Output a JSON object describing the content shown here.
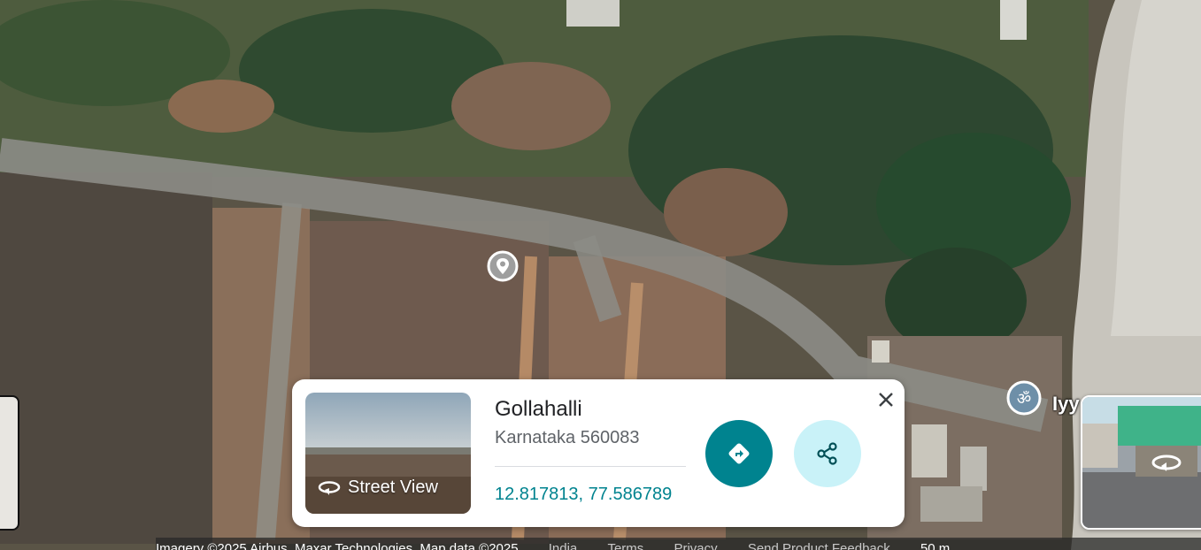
{
  "map": {
    "marker_icon": "location-pin-icon",
    "temple_label": "Iyy"
  },
  "place_card": {
    "title": "Gollahalli",
    "subtitle": "Karnataka 560083",
    "coordinates": "12.817813, 77.586789",
    "street_view_label": "Street View",
    "directions_icon": "directions-icon",
    "share_icon": "share-icon",
    "close_icon": "close-icon"
  },
  "footer": {
    "attribution": "Imagery ©2025 Airbus, Maxar Technologies, Map data ©2025",
    "links": [
      "India",
      "Terms",
      "Privacy",
      "Send Product Feedback"
    ],
    "scale": "50 m"
  },
  "colors": {
    "accent": "#00838f",
    "share_bg": "#c9f2f8"
  }
}
